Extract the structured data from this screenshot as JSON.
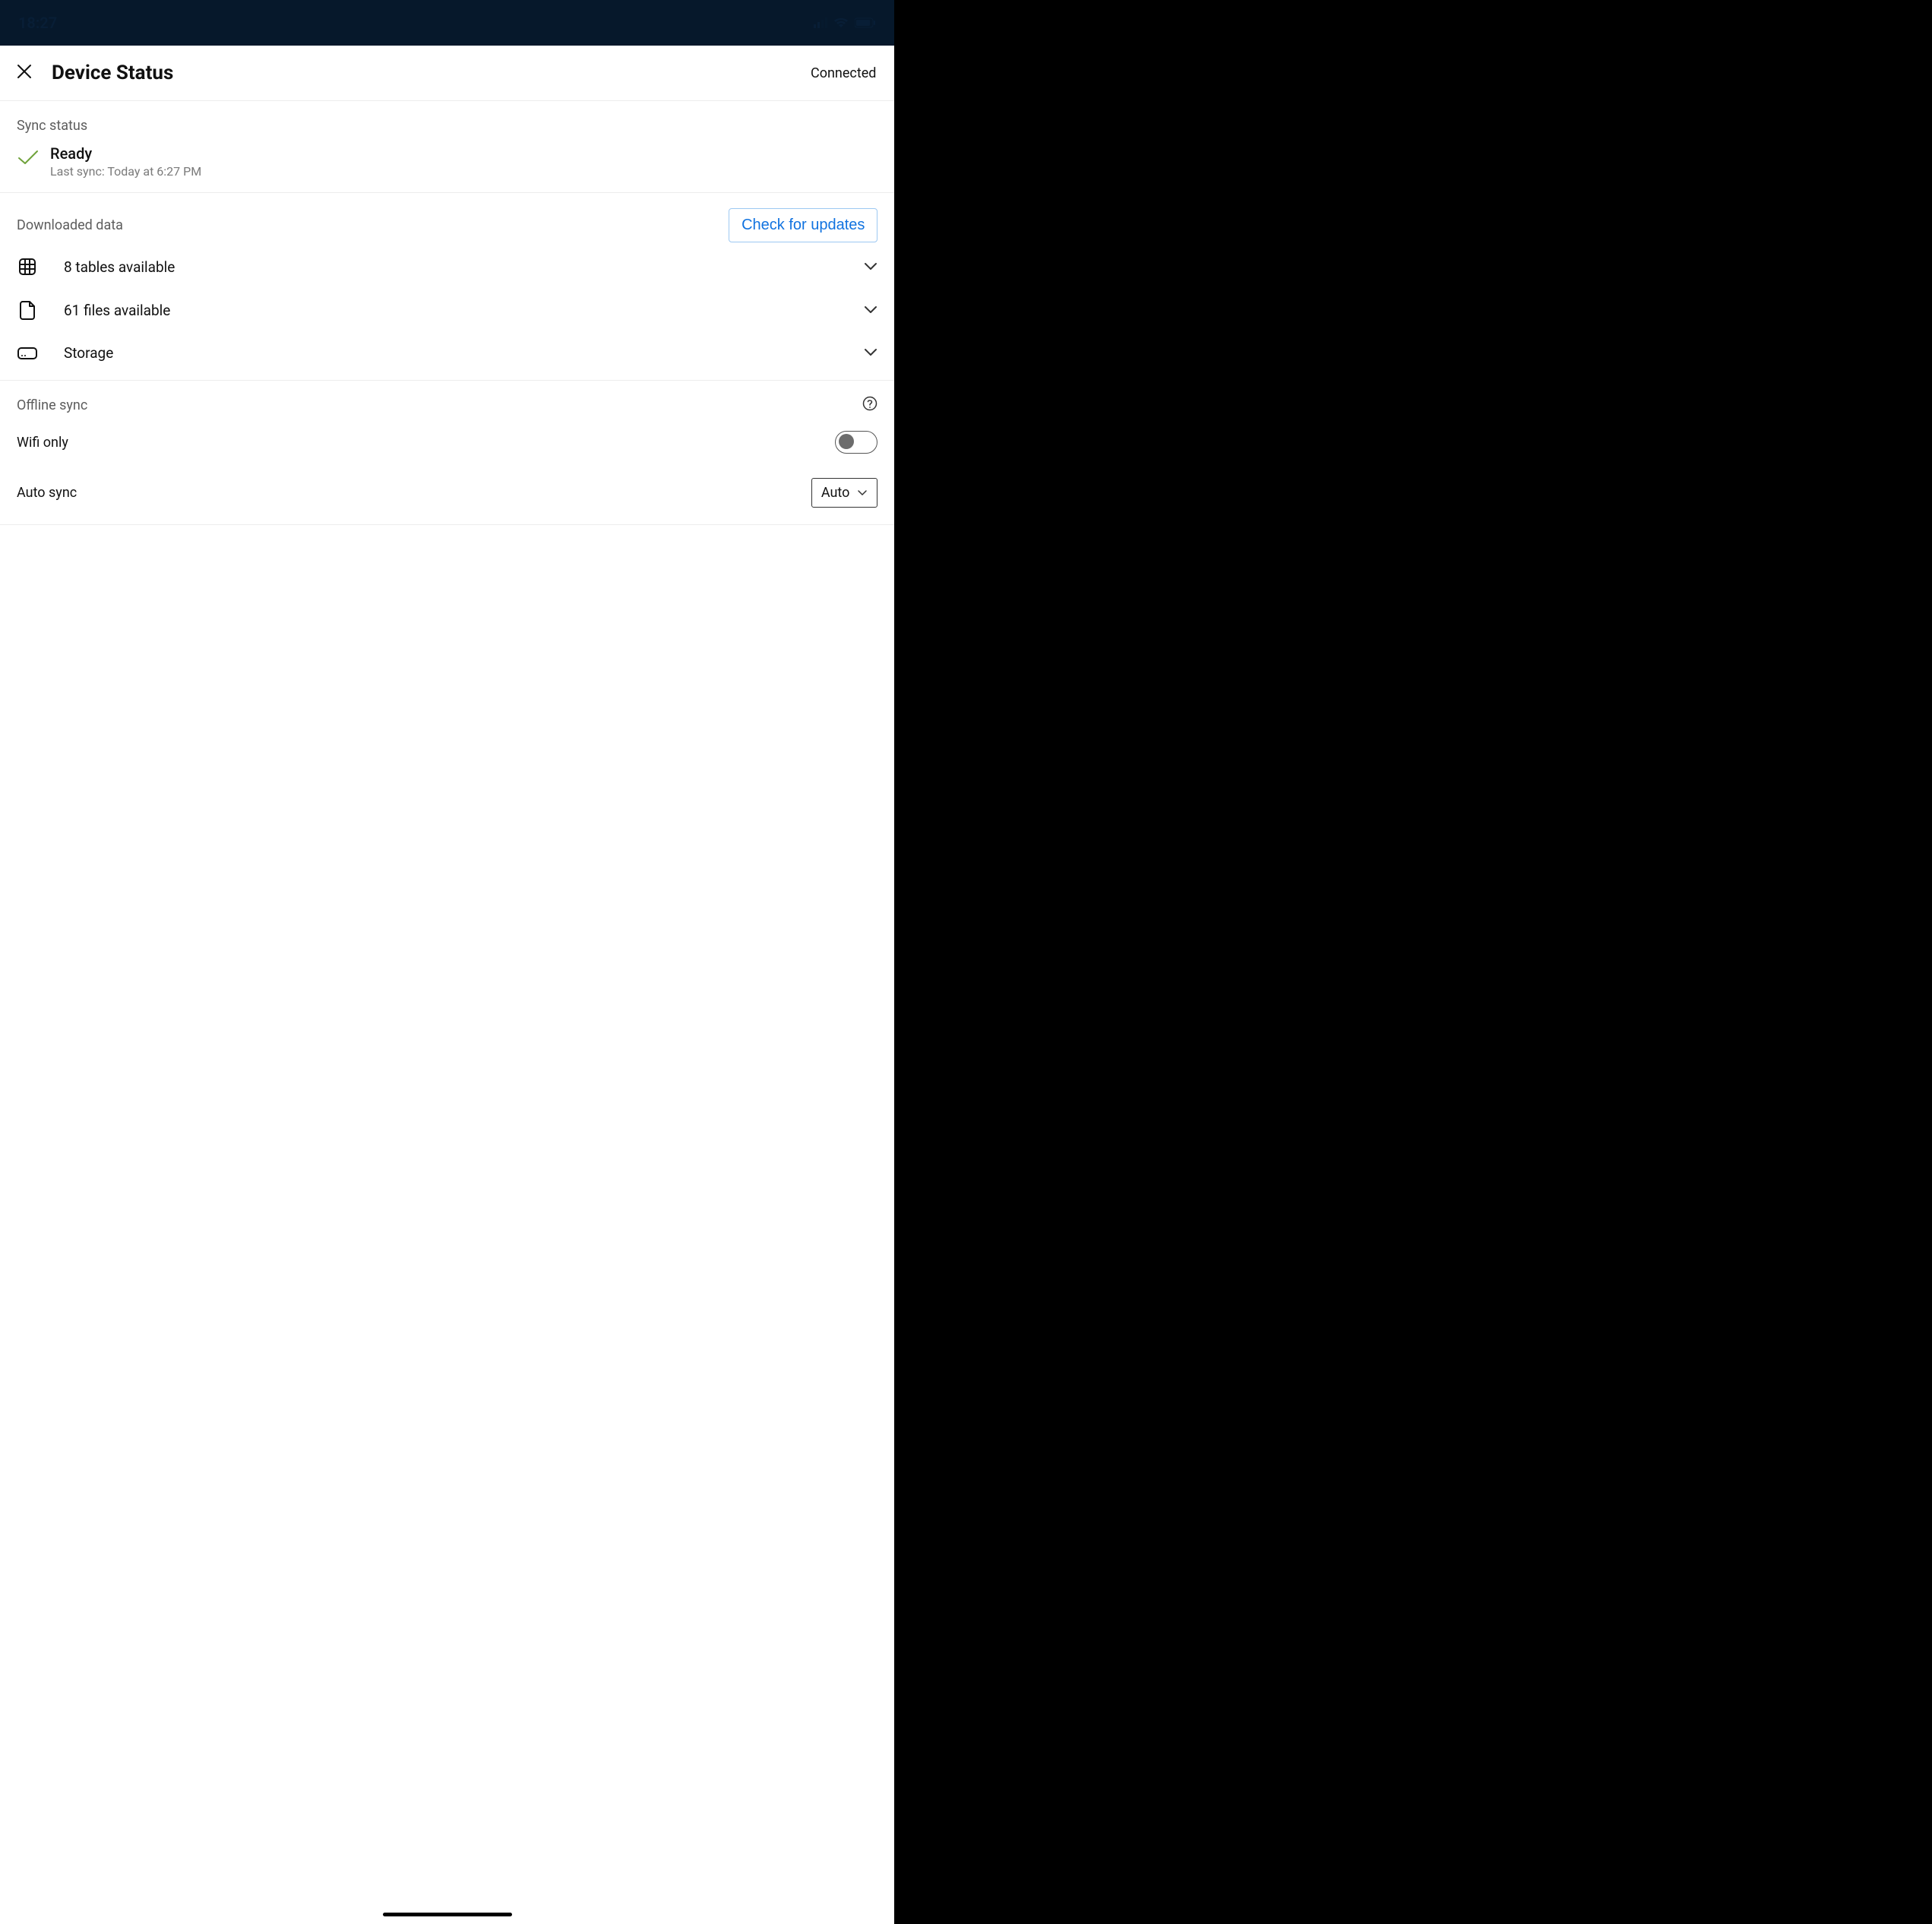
{
  "status_bar": {
    "time": "18:27"
  },
  "header": {
    "title": "Device Status",
    "connection": "Connected"
  },
  "sync": {
    "section_label": "Sync status",
    "status": "Ready",
    "last_sync": "Last sync: Today at 6:27 PM"
  },
  "downloaded": {
    "section_label": "Downloaded data",
    "check_button": "Check for updates",
    "items": [
      {
        "label": "8 tables available"
      },
      {
        "label": "61 files available"
      },
      {
        "label": "Storage"
      }
    ]
  },
  "offline": {
    "section_label": "Offline sync",
    "wifi_only_label": "Wifi only",
    "wifi_only_on": false,
    "auto_sync_label": "Auto sync",
    "auto_sync_value": "Auto"
  }
}
